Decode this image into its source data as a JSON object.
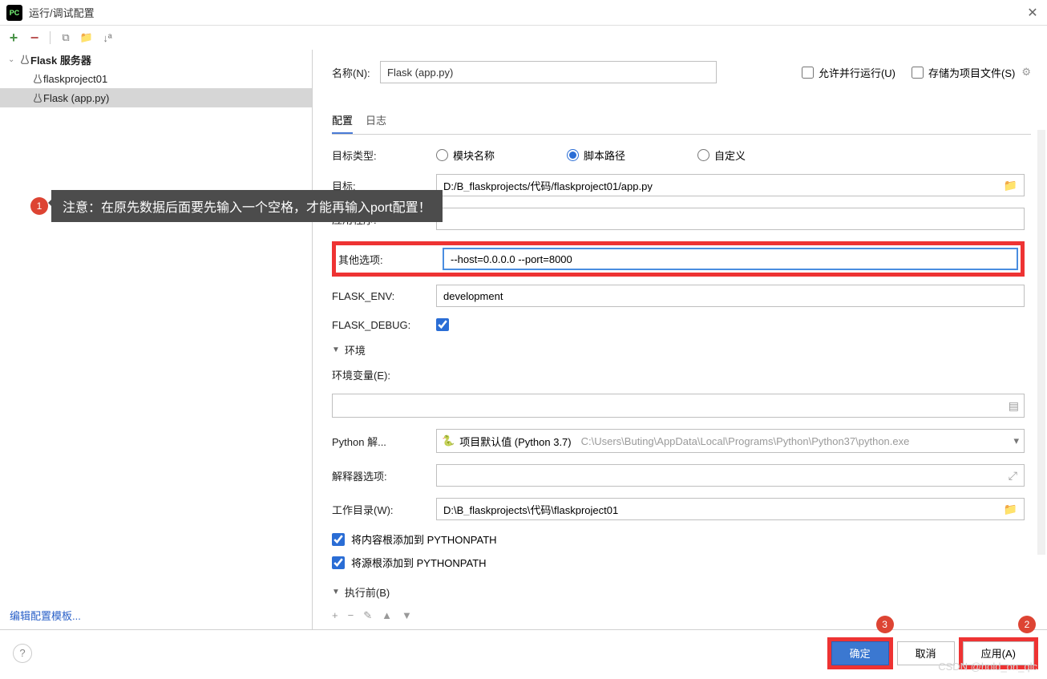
{
  "titlebar": {
    "app_icon": "PC",
    "title": "运行/调试配置"
  },
  "tree": {
    "root": "Flask 服务器",
    "items": [
      "flaskproject01",
      "Flask (app.py)"
    ],
    "selected_index": 1
  },
  "edit_template_link": "编辑配置模板...",
  "header": {
    "name_label": "名称(N):",
    "name_value": "Flask (app.py)",
    "allow_parallel": "允许并行运行(U)",
    "store_project": "存储为项目文件(S)"
  },
  "tabs": {
    "config": "配置",
    "logs": "日志"
  },
  "form": {
    "target_type_label": "目标类型:",
    "radio_module": "模块名称",
    "radio_script": "脚本路径",
    "radio_custom": "自定义",
    "target_label": "目标:",
    "target_value": "D:/B_flaskprojects/代码/flaskproject01/app.py",
    "app_label": "应用程序:",
    "app_value": "",
    "other_label": "其他选项:",
    "other_value": "--host=0.0.0.0 --port=8000",
    "flask_env_label": "FLASK_ENV:",
    "flask_env_value": "development",
    "flask_debug_label": "FLASK_DEBUG:",
    "env_section": "环境",
    "env_vars_label": "环境变量(E):",
    "python_interp_label": "Python 解...",
    "interp_name": "项目默认值 (Python 3.7)",
    "interp_path": "C:\\Users\\Buting\\AppData\\Local\\Programs\\Python\\Python37\\python.exe",
    "interp_opts_label": "解释器选项:",
    "workdir_label": "工作目录(W):",
    "workdir_value": "D:\\B_flaskprojects\\代码\\flaskproject01",
    "cb_content_root": "将内容根添加到 PYTHONPATH",
    "cb_source_root": "将源根添加到 PYTHONPATH",
    "before_launch": "执行前(B)"
  },
  "callout": {
    "num": "1",
    "text": "注意：在原先数据后面要先输入一个空格，才能再输入port配置！"
  },
  "badges": {
    "ok": "3",
    "apply": "2"
  },
  "footer": {
    "ok": "确定",
    "cancel": "取消",
    "apply": "应用(A)"
  },
  "watermark": "CSDN @hold_on_qlc"
}
